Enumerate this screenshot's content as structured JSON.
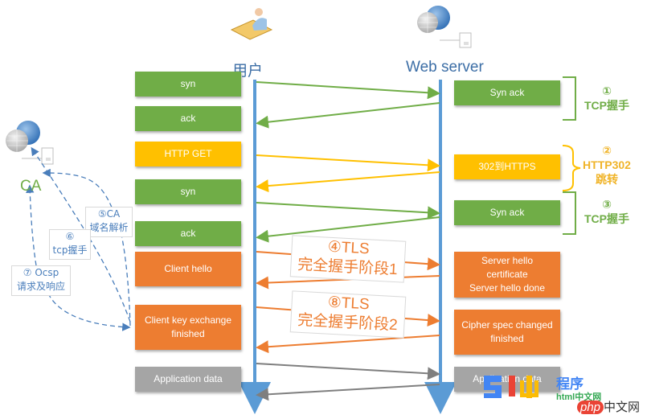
{
  "actors": {
    "client": "用户",
    "server": "Web server",
    "ca": "CA"
  },
  "client_steps": [
    {
      "label": "syn",
      "color": "green"
    },
    {
      "label": "ack",
      "color": "green"
    },
    {
      "label": "HTTP GET",
      "color": "yellow"
    },
    {
      "label": "syn",
      "color": "green"
    },
    {
      "label": "ack",
      "color": "green"
    },
    {
      "label": "Client hello",
      "color": "orange"
    },
    {
      "label": "Client key exchange\nfinished",
      "color": "orange"
    },
    {
      "label": "Application data",
      "color": "gray"
    }
  ],
  "server_steps": [
    {
      "label": "Syn ack",
      "color": "green"
    },
    {
      "label": "302到HTTPS",
      "color": "yellow"
    },
    {
      "label": "Syn ack",
      "color": "green"
    },
    {
      "label": "Server hello\ncertificate\nServer hello done",
      "color": "orange"
    },
    {
      "label": "Cipher spec changed\nfinished",
      "color": "orange"
    },
    {
      "label": "Application data",
      "color": "gray"
    }
  ],
  "phases": [
    {
      "label": "①\nTCP握手",
      "color": "#70ad47"
    },
    {
      "label": "②\nHTTP302\n跳转",
      "color": "#f0b429"
    },
    {
      "label": "③\nTCP握手",
      "color": "#70ad47"
    },
    {
      "label": "④TLS\n完全握手阶段1",
      "color": "#ed7d31"
    },
    {
      "label": "⑧TLS\n完全握手阶段2",
      "color": "#ed7d31"
    }
  ],
  "ca_steps": [
    {
      "label": "⑤CA\n域名解析"
    },
    {
      "label": "⑥\ntcp握手"
    },
    {
      "label": "⑦ Ocsp\n请求及响应"
    }
  ],
  "colors": {
    "lifeline": "#5b9bd5",
    "green": "#70ad47",
    "yellow": "#ffc000",
    "orange": "#ed7d31",
    "gray": "#7f7f7f",
    "dashed": "#4a7ebb"
  },
  "watermark": {
    "brand1": "程序",
    "brand2": "html中文网",
    "brand3": "php中文网"
  }
}
